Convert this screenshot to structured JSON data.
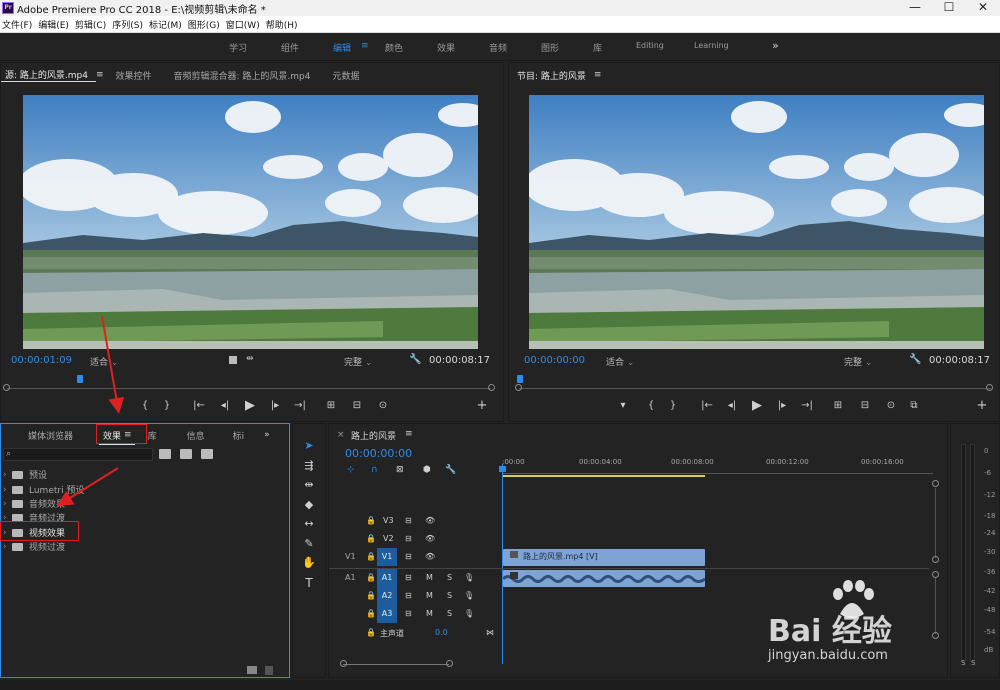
{
  "window": {
    "title": "Adobe Premiere Pro CC 2018 - E:\\视频剪辑\\未命名 *",
    "logo": "Pr",
    "controls": [
      "—",
      "☐",
      "✕"
    ]
  },
  "menu": [
    "文件(F)",
    "编辑(E)",
    "剪辑(C)",
    "序列(S)",
    "标记(M)",
    "图形(G)",
    "窗口(W)",
    "帮助(H)"
  ],
  "workspaces": {
    "items": [
      "学习",
      "组件",
      "编辑",
      "颜色",
      "效果",
      "音频",
      "图形",
      "库",
      "Editing",
      "Learning"
    ],
    "active": "编辑",
    "active_menu": "≡",
    "overflow": "»"
  },
  "source_monitor": {
    "tabs": [
      "源: 路上的风景.mp4",
      "效果控件",
      "音频剪辑混合器: 路上的风景.mp4",
      "元数据"
    ],
    "menu_icon": "≡",
    "timecode_current": "00:00:01:09",
    "zoom": "适合",
    "quality": "完整",
    "timecode_duration": "00:00:08:17",
    "controls": [
      "▾",
      "{",
      "}",
      "|←",
      "◂|",
      "▶",
      "|▸",
      "→|",
      "⊞",
      "⊟",
      "⊙",
      "+"
    ]
  },
  "program_monitor": {
    "title": "节目: 路上的风景",
    "menu_icon": "≡",
    "timecode_current": "00:00:00:00",
    "zoom": "适合",
    "quality": "完整",
    "timecode_duration": "00:00:08:17",
    "controls": [
      "▾",
      "{",
      "}",
      "|←",
      "◂|",
      "▶",
      "|▸",
      "→|",
      "⊞",
      "⊟",
      "⊙",
      "⧉",
      "+"
    ]
  },
  "project_panel": {
    "tabs": [
      "媒体浏览器",
      "效果",
      "库",
      "信息",
      "标i"
    ],
    "active_tab": "效果",
    "menu_icon": "≡",
    "overflow": "»",
    "search_icon_glyph": "⌕",
    "tree": [
      {
        "label": "预设",
        "icon": "folder-star-icon"
      },
      {
        "label": "Lumetri 预设",
        "icon": "folder-star-icon"
      },
      {
        "label": "音频效果",
        "icon": "folder-icon"
      },
      {
        "label": "音频过渡",
        "icon": "folder-icon"
      },
      {
        "label": "视频效果",
        "icon": "folder-icon"
      },
      {
        "label": "视频过渡",
        "icon": "folder-icon"
      }
    ]
  },
  "timeline": {
    "sequence_name": "路上的风景",
    "menu_icon": "≡",
    "close_icon": "×",
    "timecode": "00:00:00:00",
    "ruler": [
      ":00:00",
      "00:00:04:00",
      "00:00:08:00",
      "00:00:12:00",
      "00:00:16:00"
    ],
    "tracks": [
      {
        "name": "V3"
      },
      {
        "name": "V2"
      },
      {
        "name": "V1",
        "source": "V1"
      },
      {
        "name": "A1",
        "source": "A1"
      },
      {
        "name": "A2"
      },
      {
        "name": "A3"
      }
    ],
    "track_buttons": {
      "mute": "M",
      "solo": "S"
    },
    "master": {
      "label": "主声道",
      "value": "0.0"
    },
    "video_clip": "路上的风景.mp4 [V]",
    "audio_meter_labels": [
      "0",
      "-6",
      "-12",
      "-18",
      "-24",
      "-30",
      "-36",
      "-42",
      "-48",
      "-54",
      "dB"
    ],
    "meter_solo": [
      "S",
      "S"
    ]
  },
  "watermark": {
    "brand": "Bai 经验",
    "url": "jingyan.baidu.com"
  },
  "colors": {
    "accent": "#2d8ceb",
    "clip_video": "#7ea3d5",
    "annotation": "#e02020"
  }
}
